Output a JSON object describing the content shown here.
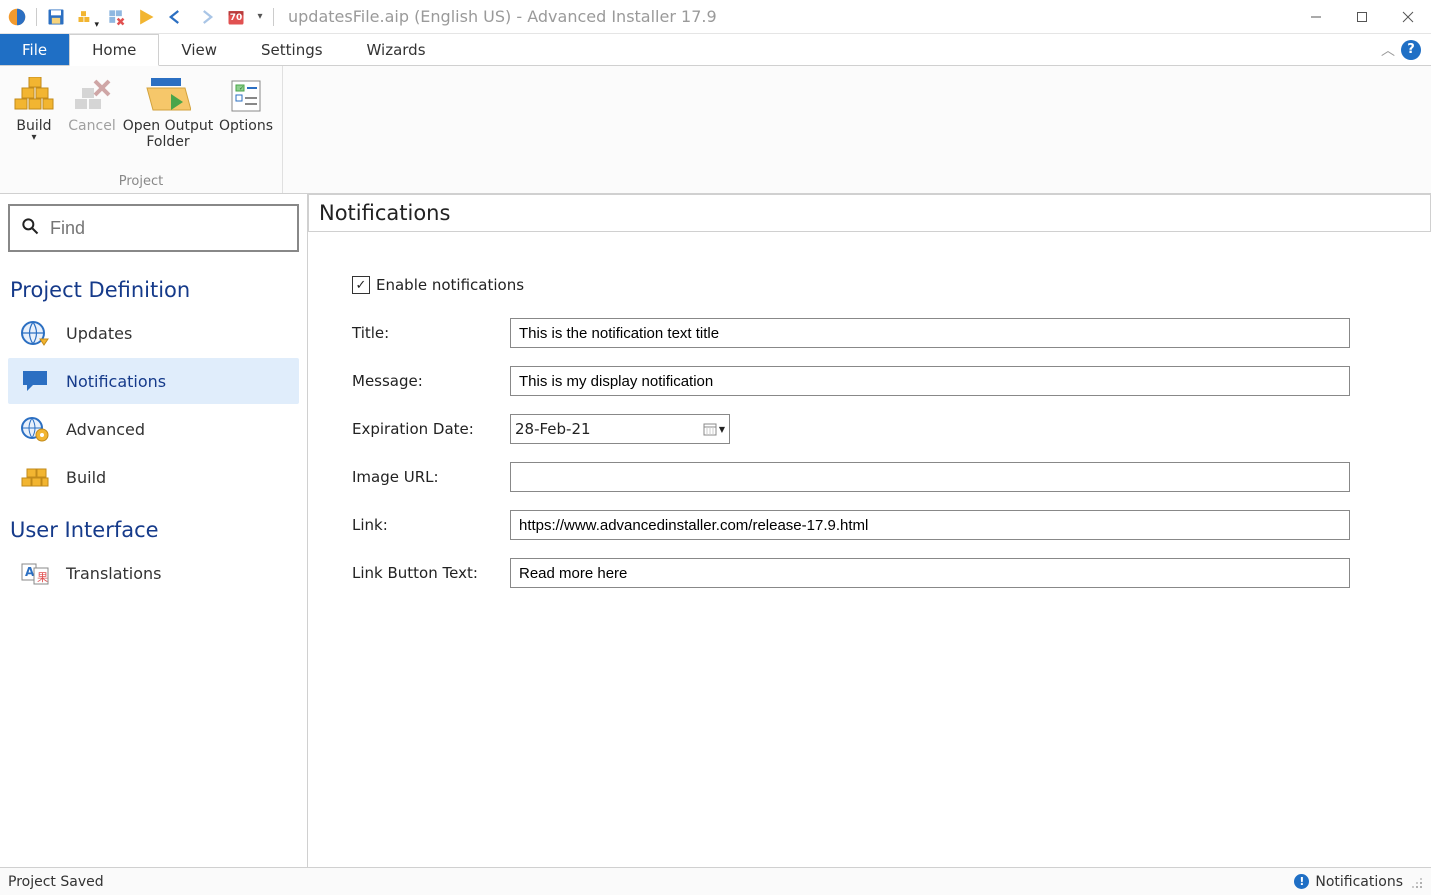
{
  "window": {
    "title": "updatesFile.aip (English US) - Advanced Installer 17.9",
    "badge": "70"
  },
  "tabs": {
    "file": "File",
    "home": "Home",
    "view": "View",
    "settings": "Settings",
    "wizards": "Wizards"
  },
  "ribbon": {
    "build": "Build",
    "cancel": "Cancel",
    "open_output": "Open Output Folder",
    "options": "Options",
    "group_project": "Project"
  },
  "sidebar": {
    "find_placeholder": "Find",
    "section_project": "Project Definition",
    "section_ui": "User Interface",
    "updates": "Updates",
    "notifications": "Notifications",
    "advanced": "Advanced",
    "build": "Build",
    "translations": "Translations"
  },
  "content": {
    "title": "Notifications",
    "enable_label": "Enable notifications",
    "fields": {
      "title_label": "Title:",
      "title_value": "This is the notification text title",
      "message_label": "Message:",
      "message_value": "This is my display notification",
      "expiration_label": "Expiration Date:",
      "expiration_value": "28-Feb-21",
      "imageurl_label": "Image URL:",
      "imageurl_value": "",
      "link_label": "Link:",
      "link_value": "https://www.advancedinstaller.com/release-17.9.html",
      "linkbtn_label": "Link Button Text:",
      "linkbtn_value": "Read more here"
    }
  },
  "statusbar": {
    "left": "Project Saved",
    "right": "Notifications"
  }
}
